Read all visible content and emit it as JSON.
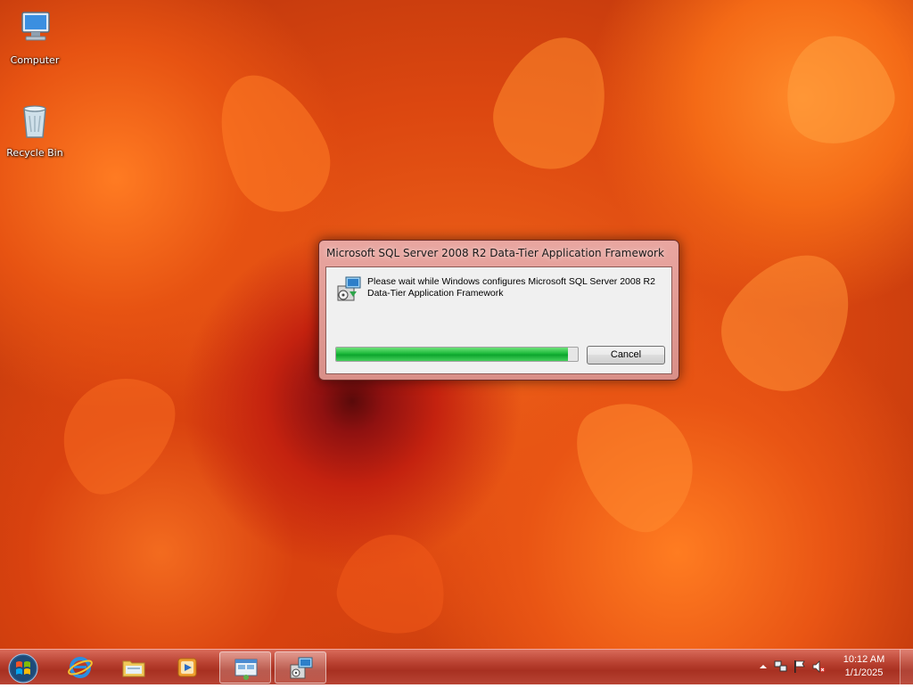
{
  "desktop": {
    "icons": [
      {
        "label": "Computer",
        "icon": "computer-icon"
      },
      {
        "label": "Recycle Bin",
        "icon": "recycle-bin-icon"
      }
    ]
  },
  "dialog": {
    "title": "Microsoft SQL Server 2008 R2 Data-Tier Application Framework",
    "message_line1": "Please wait while Windows configures Microsoft SQL Server 2008 R2",
    "message_line2": "Data-Tier Application Framework",
    "progress_percent": 96,
    "cancel_label": "Cancel",
    "icon": "installer-icon"
  },
  "taskbar": {
    "start_icon": "windows-start-icon",
    "pinned": [
      {
        "name": "internet-explorer",
        "icon": "ie-icon"
      },
      {
        "name": "windows-explorer",
        "icon": "folder-icon"
      },
      {
        "name": "media-player",
        "icon": "media-player-icon"
      },
      {
        "name": "remote-desktop",
        "icon": "network-window-icon",
        "active": true
      },
      {
        "name": "installer",
        "icon": "installer-icon",
        "active": true
      }
    ],
    "tray": {
      "icons": [
        "show-hidden-icons-arrow",
        "network-icon",
        "action-center-flag-icon",
        "volume-muted-icon"
      ],
      "time": "10:12 AM",
      "date": "1/1/2025"
    }
  },
  "colors": {
    "taskbar": "#b8402f",
    "dialog_frame": "#e9a6a0",
    "progress_fill": "#1cb93a"
  }
}
